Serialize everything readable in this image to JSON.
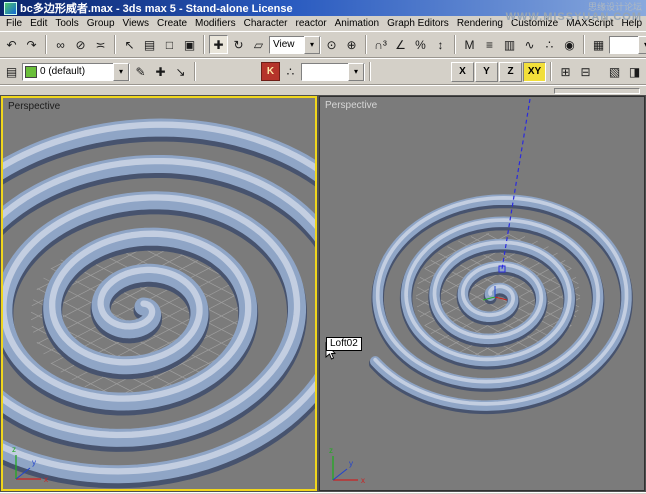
{
  "window": {
    "title": "bc多边形威者.max - 3ds max 5 - Stand-alone License",
    "watermark_top": "思缘设计论坛",
    "watermark_bottom": "WWW.MISSYUAN.COM"
  },
  "menu": {
    "items": [
      "File",
      "Edit",
      "Tools",
      "Group",
      "Views",
      "Create",
      "Modifiers",
      "Character",
      "reactor",
      "Animation",
      "Graph Editors",
      "Rendering",
      "Customize",
      "MAXScript",
      "Help"
    ]
  },
  "toolbar_main": {
    "view_dropdown": "View",
    "render_combo": "",
    "icons": {
      "dropdown_arrow": "▾",
      "undo": "↶",
      "redo": "↷",
      "link": "∞",
      "unlink": "⊘",
      "bind": "≍",
      "select": "↖",
      "select_by_name": "▤",
      "rect_region": "□",
      "crossing": "▣",
      "move": "✚",
      "rotate": "↻",
      "scale": "▱",
      "use_center": "⊙",
      "manipulate": "⊕",
      "snap3": "∩³",
      "snap_angle": "∠",
      "snap_percent": "%",
      "snap_spinner": "↕",
      "mirror": "M",
      "align": "≡",
      "layer_mgr": "▥",
      "curve_editor": "∿",
      "schematic": "∴",
      "material": "◉",
      "render": "▦",
      "quick_render": "▨",
      "nav_prev": "◀",
      "nav_next": "▶",
      "extras1": "≣",
      "extras2": "▧"
    }
  },
  "toolbar_second": {
    "layer_dropdown": "0 (default)",
    "combo2": "",
    "axis": {
      "x": "X",
      "y": "Y",
      "z": "Z",
      "xy": "XY"
    },
    "icons": {
      "layers": "▤",
      "edit": "✎",
      "add": "✚",
      "pick": "↘",
      "override": "K",
      "schem2": "∴",
      "more1": "⊞",
      "more2": "⊟",
      "r1": "▧",
      "r2": "◨"
    }
  },
  "viewports": {
    "left": {
      "label": "Perspective"
    },
    "right": {
      "label": "Perspective",
      "tooltip": "Loft02"
    },
    "axis_labels": {
      "x": "x",
      "y": "y",
      "z": "z"
    }
  },
  "scene": {
    "viewport_bg": "#7b7b7b",
    "spiral_main": "#8fa5c6",
    "spiral_shadow": "#47536e",
    "spiral_highlight": "#c9d3e3",
    "grid": "#9f9f9f",
    "path_line": "#2b2bdd",
    "active_viewport_border": "#f0d61c",
    "active_axis_button": "#f2df3a",
    "layer_swatch": "#6abf3a",
    "tripod_x": "#cc2222",
    "tripod_y": "#2244cc",
    "tripod_z": "#22aa22"
  }
}
